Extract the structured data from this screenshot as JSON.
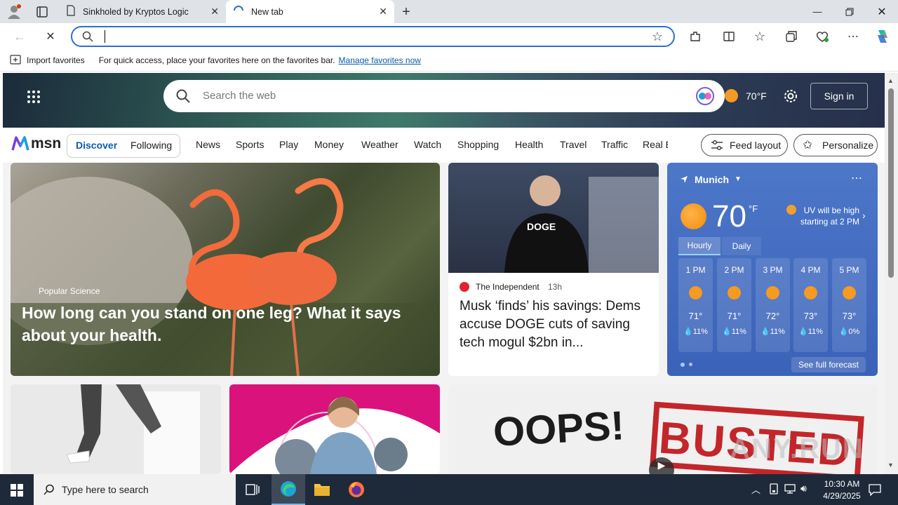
{
  "browser": {
    "tabs": [
      {
        "title": "Sinkholed by Kryptos Logic"
      },
      {
        "title": "New tab"
      }
    ],
    "address_value": "",
    "favorites_bar": {
      "import_label": "Import favorites",
      "hint": "For quick access, place your favorites here on the favorites bar.",
      "manage_link": "Manage favorites now"
    }
  },
  "msn": {
    "search_placeholder": "Search the web",
    "weather_temp": "70°F",
    "sign_in": "Sign in",
    "logo_text": "msn",
    "feed_tabs": [
      "Discover",
      "Following"
    ],
    "nav": [
      "News",
      "Sports",
      "Play",
      "Money",
      "Weather",
      "Watch",
      "Shopping",
      "Health",
      "Travel",
      "Traffic",
      "Real E"
    ],
    "feed_layout": "Feed layout",
    "personalize": "Personalize",
    "hero_article": {
      "source": "Popular Science",
      "title": "How long can you stand on one leg? What it says about your health."
    },
    "side_article": {
      "source": "The Independent",
      "age": "13h",
      "title": "Musk ‘finds’ his savings: Dems accuse DOGE cuts of saving tech mogul $2bn in..."
    },
    "weather_card": {
      "city": "Munich",
      "temp": "70",
      "unit": "°F",
      "alert": "UV will be high starting at 2 PM",
      "tabs": [
        "Hourly",
        "Daily"
      ],
      "hours": [
        {
          "time": "1 PM",
          "temp": "71°",
          "precip": "11%"
        },
        {
          "time": "2 PM",
          "temp": "71°",
          "precip": "11%"
        },
        {
          "time": "3 PM",
          "temp": "72°",
          "precip": "11%"
        },
        {
          "time": "4 PM",
          "temp": "73°",
          "precip": "11%"
        },
        {
          "time": "5 PM",
          "temp": "73°",
          "precip": "0%"
        }
      ],
      "see_full": "See full forecast"
    },
    "bottom_cards": {
      "oops_text": "OOPS!",
      "busted_text": "BUSTED"
    }
  },
  "taskbar": {
    "search_placeholder": "Type here to search",
    "time": "10:30 AM",
    "date": "4/29/2025"
  },
  "watermark": "ANY.RUN",
  "colors": {
    "accent": "#2a6fd6",
    "weather_card": "#3a62b8",
    "taskbar": "#1e2a3a"
  }
}
